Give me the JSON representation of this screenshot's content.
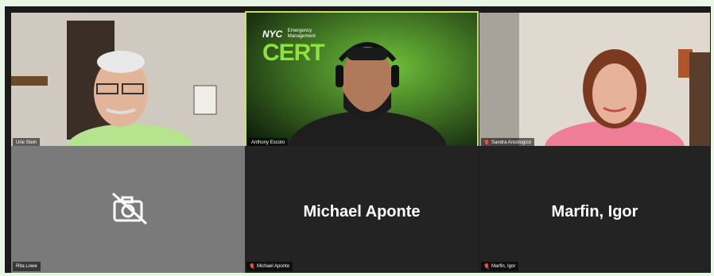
{
  "meeting": {
    "participants": [
      {
        "name": "Urie Stein",
        "video": "on",
        "muted": false
      },
      {
        "name": "Anthony Escoto",
        "video": "on",
        "active_speaker": true,
        "muted": false
      },
      {
        "name": "Sandra Ancologico",
        "video": "on",
        "muted": true
      },
      {
        "name": "Rita Lowe",
        "video": "off",
        "muted": false
      },
      {
        "name": "Michael Aponte",
        "video": "off",
        "muted": true
      },
      {
        "name": "Marfin, Igor",
        "video": "off",
        "muted": true
      }
    ],
    "background_logo": {
      "nyc": "NYC",
      "line1": "Emergency",
      "line2": "Management",
      "cert": "CERT"
    }
  },
  "icons": {
    "camera_off": "camera-off-icon",
    "mic_muted": "mic-muted-icon"
  },
  "colors": {
    "active_speaker_border": "#c7e25a",
    "muted_icon": "#e74c3c"
  }
}
